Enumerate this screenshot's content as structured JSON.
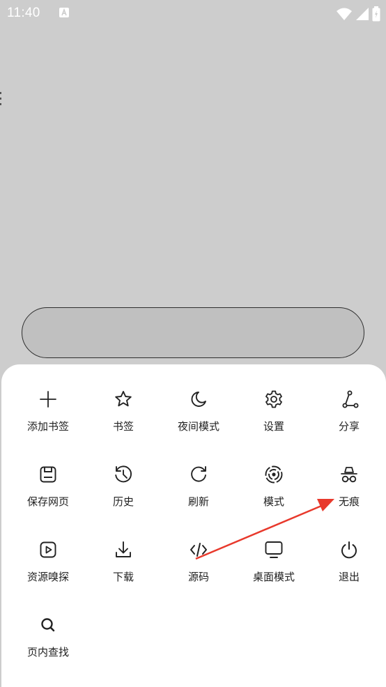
{
  "status_bar": {
    "time": "11:40",
    "icons": [
      "notification-a-icon",
      "wifi-icon",
      "signal-icon",
      "battery-icon"
    ]
  },
  "address_bar": {
    "value": ""
  },
  "menu": {
    "items": [
      {
        "label": "添加书签",
        "icon": "plus-icon"
      },
      {
        "label": "书签",
        "icon": "star-icon"
      },
      {
        "label": "夜间模式",
        "icon": "moon-icon"
      },
      {
        "label": "设置",
        "icon": "gear-icon"
      },
      {
        "label": "分享",
        "icon": "share-icon"
      },
      {
        "label": "保存网页",
        "icon": "save-icon"
      },
      {
        "label": "历史",
        "icon": "history-icon"
      },
      {
        "label": "刷新",
        "icon": "refresh-icon"
      },
      {
        "label": "模式",
        "icon": "mode-icon"
      },
      {
        "label": "无痕",
        "icon": "incognito-icon"
      },
      {
        "label": "资源嗅探",
        "icon": "play-icon"
      },
      {
        "label": "下载",
        "icon": "download-icon"
      },
      {
        "label": "源码",
        "icon": "code-icon"
      },
      {
        "label": "桌面模式",
        "icon": "monitor-icon"
      },
      {
        "label": "退出",
        "icon": "power-icon"
      },
      {
        "label": "页内查找",
        "icon": "search-icon"
      }
    ]
  },
  "annotation": {
    "arrow_color": "#e8392c"
  },
  "colors": {
    "background": "#cdcdcd",
    "sheet": "#ffffff",
    "icon": "#222222"
  }
}
